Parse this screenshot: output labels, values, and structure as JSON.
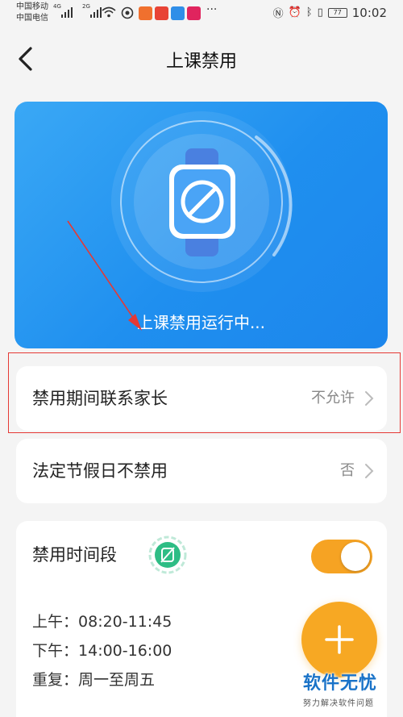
{
  "status_bar": {
    "carrier_1": "中国移动",
    "carrier_2": "中国电信",
    "net_1": "4G",
    "net_2": "2G",
    "more": "···",
    "battery": "77",
    "time": "10:02",
    "colors": {
      "app_icon_1": "#f0702e",
      "app_icon_2": "#e84335",
      "app_icon_3": "#2f8ee8",
      "app_icon_4": "#e0245e"
    }
  },
  "nav": {
    "back_icon": "chevron-left-icon",
    "title": "上课禁用"
  },
  "hero": {
    "status_text": "上课禁用运行中...",
    "icon": "watch-disabled-icon",
    "colors": {
      "bg_start": "#3aa8f5",
      "bg_end": "#1c86ec"
    }
  },
  "settings": {
    "contact_parent": {
      "label": "禁用期间联系家长",
      "value": "不允许"
    },
    "holidays": {
      "label": "法定节假日不禁用",
      "value": "否"
    }
  },
  "time_period": {
    "title": "禁用时间段",
    "toggle_on": true,
    "morning_label": "上午：",
    "morning_value": "08:20-11:45",
    "afternoon_label": "下午：",
    "afternoon_value": "14:00-16:00",
    "repeat_label": "重复：",
    "repeat_value": "周一至周五",
    "colors": {
      "accent": "#f6a323",
      "badge": "#2ebd85"
    }
  },
  "annotation": {
    "color": "#e53935"
  },
  "watermark": {
    "title": "软件无忧",
    "subtitle": "努力解决软件问题"
  }
}
